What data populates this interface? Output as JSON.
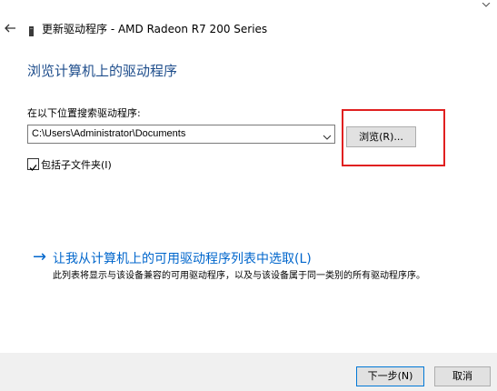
{
  "window": {
    "title": "更新驱动程序 - AMD Radeon R7 200 Series",
    "back_icon": "back-arrow-icon",
    "close_icon": "close-icon",
    "device_icon": "device-manager-icon"
  },
  "main": {
    "heading": "浏览计算机上的驱动程序",
    "search_label": "在以下位置搜索驱动程序:",
    "path_value": "C:\\Users\\Administrator\\Documents",
    "browse_button": "浏览(R)...",
    "include_subfolders_label": "包括子文件夹(I)",
    "include_subfolders_checked": true,
    "pick_link": {
      "arrow": "→",
      "text": "让我从计算机上的可用驱动程序列表中选取(L)",
      "description": "此列表将显示与该设备兼容的可用驱动程序，以及与该设备属于同一类别的所有驱动程序序。"
    }
  },
  "footer": {
    "next_button": "下一步(N)",
    "cancel_button": "取消"
  },
  "colors": {
    "heading": "#1f4e8c",
    "link": "#0066cc",
    "highlight": "#e02020",
    "footer_bg": "#f0f0f0"
  }
}
